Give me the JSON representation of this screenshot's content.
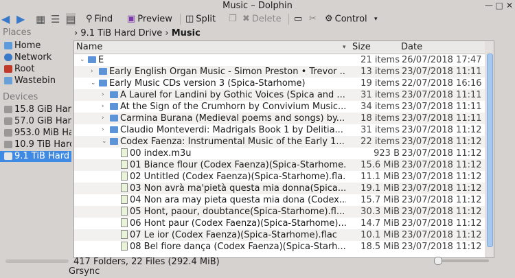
{
  "window": {
    "title": "Music – Dolphin",
    "btn_min": "—",
    "btn_max": "□",
    "btn_close": "✕"
  },
  "toolbar": {
    "find": "Find",
    "preview": "Preview",
    "split": "Split",
    "delete": "Delete",
    "control": "Control"
  },
  "sidebar": {
    "places_heading": "Places",
    "places": [
      {
        "label": "Home",
        "color": "#5e9bdc"
      },
      {
        "label": "Network",
        "color": "#3a78c8"
      },
      {
        "label": "Root",
        "color": "#c0392b"
      },
      {
        "label": "Wastebin",
        "color": "#6aa0d8"
      }
    ],
    "devices_heading": "Devices",
    "devices": [
      {
        "label": "15.8 GiB Har"
      },
      {
        "label": "57.0 GiB Har"
      },
      {
        "label": "953.0 MiB Ha"
      },
      {
        "label": "10.9 TiB Hard"
      },
      {
        "label": "9.1 TiB Hard"
      }
    ]
  },
  "breadcrumb": {
    "parent": "9.1 TiB Hard Drive",
    "current": "Music"
  },
  "columns": {
    "name": "Name",
    "size": "Size",
    "date": "Date"
  },
  "rows": [
    {
      "name": "E",
      "size": "21 items",
      "date": "26/07/2018 17:47",
      "type": "folder",
      "indent": 0,
      "exp": "⌄"
    },
    {
      "name": "Early English Organ Music - Simon Preston • Trevor ...",
      "size": "13 items",
      "date": "23/07/2018 11:11",
      "type": "folder",
      "indent": 1,
      "exp": "›"
    },
    {
      "name": "Early Music CDs version 3  (Spica-Starhome)",
      "size": "19 items",
      "date": "22/07/2018 16:16",
      "type": "folder",
      "indent": 1,
      "exp": "⌄"
    },
    {
      "name": "A Laurel for Landini by Gothic Voices (Spica and ...",
      "size": "31 items",
      "date": "23/07/2018 11:11",
      "type": "folder",
      "indent": 2,
      "exp": "›"
    },
    {
      "name": "At the Sign of the Crumhorn by Convivium Music...",
      "size": "34 items",
      "date": "23/07/2018 11:11",
      "type": "folder",
      "indent": 2,
      "exp": "›"
    },
    {
      "name": "Carmina Burana (Medieval poems and songs) by...",
      "size": "18 items",
      "date": "23/07/2018 11:11",
      "type": "folder",
      "indent": 2,
      "exp": "›"
    },
    {
      "name": "Claudio Monteverdi: Madrigals Book 1 by Delitia...",
      "size": "31 items",
      "date": "23/07/2018 11:12",
      "type": "folder",
      "indent": 2,
      "exp": "›"
    },
    {
      "name": "Codex Faenza: Instrumental Music of the Early 1...",
      "size": "22 items",
      "date": "23/07/2018 11:12",
      "type": "folder",
      "indent": 2,
      "exp": "⌄"
    },
    {
      "name": "00 index.m3u",
      "size": "923 B",
      "date": "23/07/2018 11:12",
      "type": "file",
      "indent": 3,
      "exp": ""
    },
    {
      "name": "01 Biance flour (Codex Faenza)(Spica-Starhome...",
      "size": "15.6 MiB",
      "date": "23/07/2018 11:12",
      "type": "file",
      "indent": 3,
      "exp": ""
    },
    {
      "name": "02 Untitled (Codex Faenza)(Spica-Starhome).fla...",
      "size": "11.1 MiB",
      "date": "23/07/2018 11:12",
      "type": "file",
      "indent": 3,
      "exp": ""
    },
    {
      "name": "03 Non avrà ma'pietà questa mia donna(Spica...",
      "size": "19.1 MiB",
      "date": "23/07/2018 11:12",
      "type": "file",
      "indent": 3,
      "exp": ""
    },
    {
      "name": "04 Non ara may pieta questa mia dona (Codex...",
      "size": "15.7 MiB",
      "date": "23/07/2018 11:12",
      "type": "file",
      "indent": 3,
      "exp": ""
    },
    {
      "name": "05 Hont, paour, doubtance(Spica-Starhome).fl...",
      "size": "30.3 MiB",
      "date": "23/07/2018 11:12",
      "type": "file",
      "indent": 3,
      "exp": ""
    },
    {
      "name": "06 Hont paur (Codex Faenza)(Spica-Starhome)...",
      "size": "14.7 MiB",
      "date": "23/07/2018 11:12",
      "type": "file",
      "indent": 3,
      "exp": ""
    },
    {
      "name": "07 Le ior (Codex Faenza)(Spica-Starhome).flac",
      "size": "10.1 MiB",
      "date": "23/07/2018 11:12",
      "type": "file",
      "indent": 3,
      "exp": ""
    },
    {
      "name": "08 Bel fiore dança (Codex Faenza)(Spica-Starh...",
      "size": "18.5 MiB",
      "date": "23/07/2018 11:12",
      "type": "file",
      "indent": 3,
      "exp": ""
    }
  ],
  "status": {
    "text": "417 Folders, 22 Files (292.4 MiB)"
  },
  "taskbar": {
    "app": "Grsync"
  }
}
